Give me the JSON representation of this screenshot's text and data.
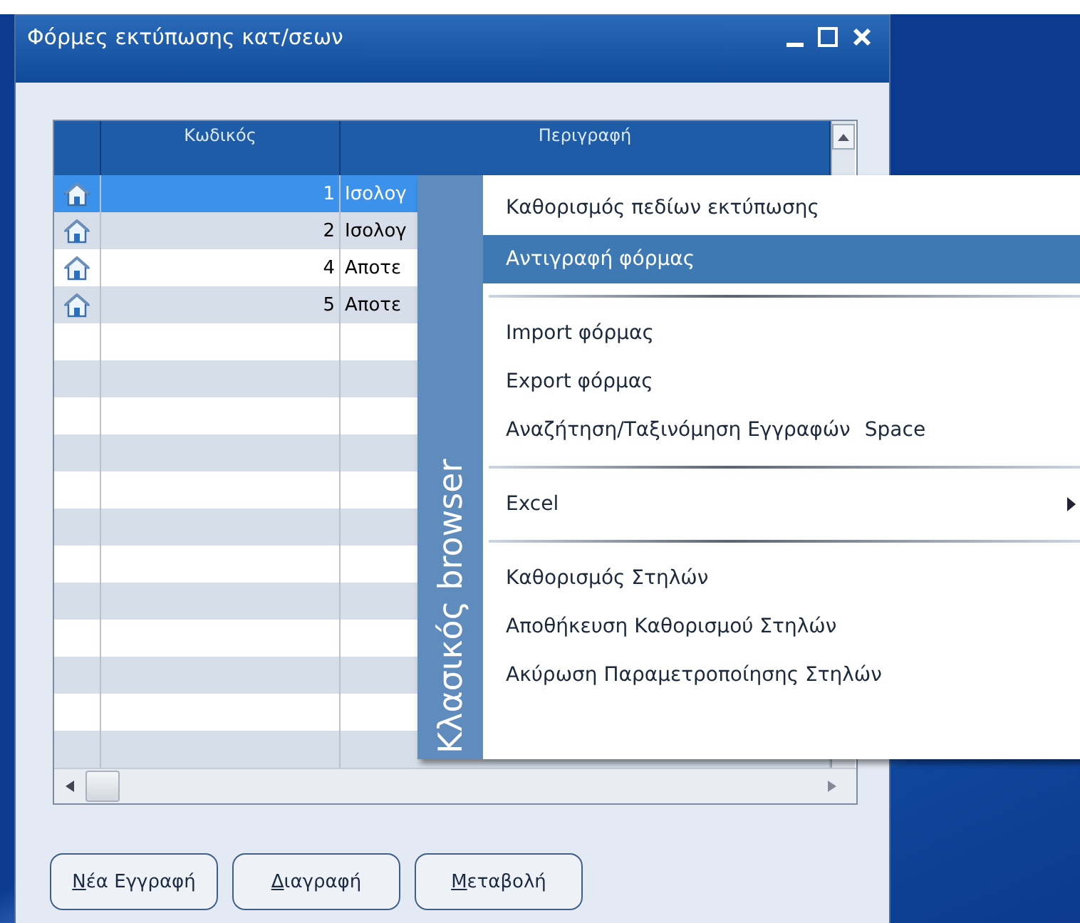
{
  "window": {
    "title": "Φόρμες εκτύπωσης κατ/σεων"
  },
  "table": {
    "columns": [
      "Κωδικός",
      "Περιγραφή"
    ],
    "rows": [
      {
        "code": "1",
        "description": "Ισολογ",
        "selected": true
      },
      {
        "code": "2",
        "description": "Ισολογ",
        "selected": false
      },
      {
        "code": "4",
        "description": "Αποτε",
        "selected": false
      },
      {
        "code": "5",
        "description": "Αποτε",
        "selected": false
      }
    ]
  },
  "buttons": [
    {
      "label": "Νέα Εγγραφή",
      "underline_first": true
    },
    {
      "label": "Διαγραφή",
      "underline_first": true
    },
    {
      "label": "Μεταβολή",
      "underline_first": true
    }
  ],
  "context_menu": {
    "side_title": "Κλασικός browser",
    "items": [
      {
        "kind": "item",
        "label": "Καθορισμός πεδίων εκτύπωσης",
        "selected": false
      },
      {
        "kind": "item",
        "label": "Αντιγραφή φόρμας",
        "selected": true
      },
      {
        "kind": "separator"
      },
      {
        "kind": "item",
        "label": "Import φόρμας",
        "selected": false
      },
      {
        "kind": "item",
        "label": "Export φόρμας",
        "selected": false
      },
      {
        "kind": "item",
        "label": "Αναζήτηση/Ταξινόμηση Εγγραφών",
        "shortcut": "Space",
        "selected": false
      },
      {
        "kind": "separator"
      },
      {
        "kind": "item",
        "label": "Excel",
        "submenu": true,
        "selected": false
      },
      {
        "kind": "separator"
      },
      {
        "kind": "item",
        "label": "Καθορισμός Στηλών",
        "selected": false
      },
      {
        "kind": "item",
        "label": "Αποθήκευση Καθορισμού Στηλών",
        "selected": false
      },
      {
        "kind": "item",
        "label": "Ακύρωση Παραμετροποίησης Στηλών",
        "selected": false
      }
    ]
  }
}
